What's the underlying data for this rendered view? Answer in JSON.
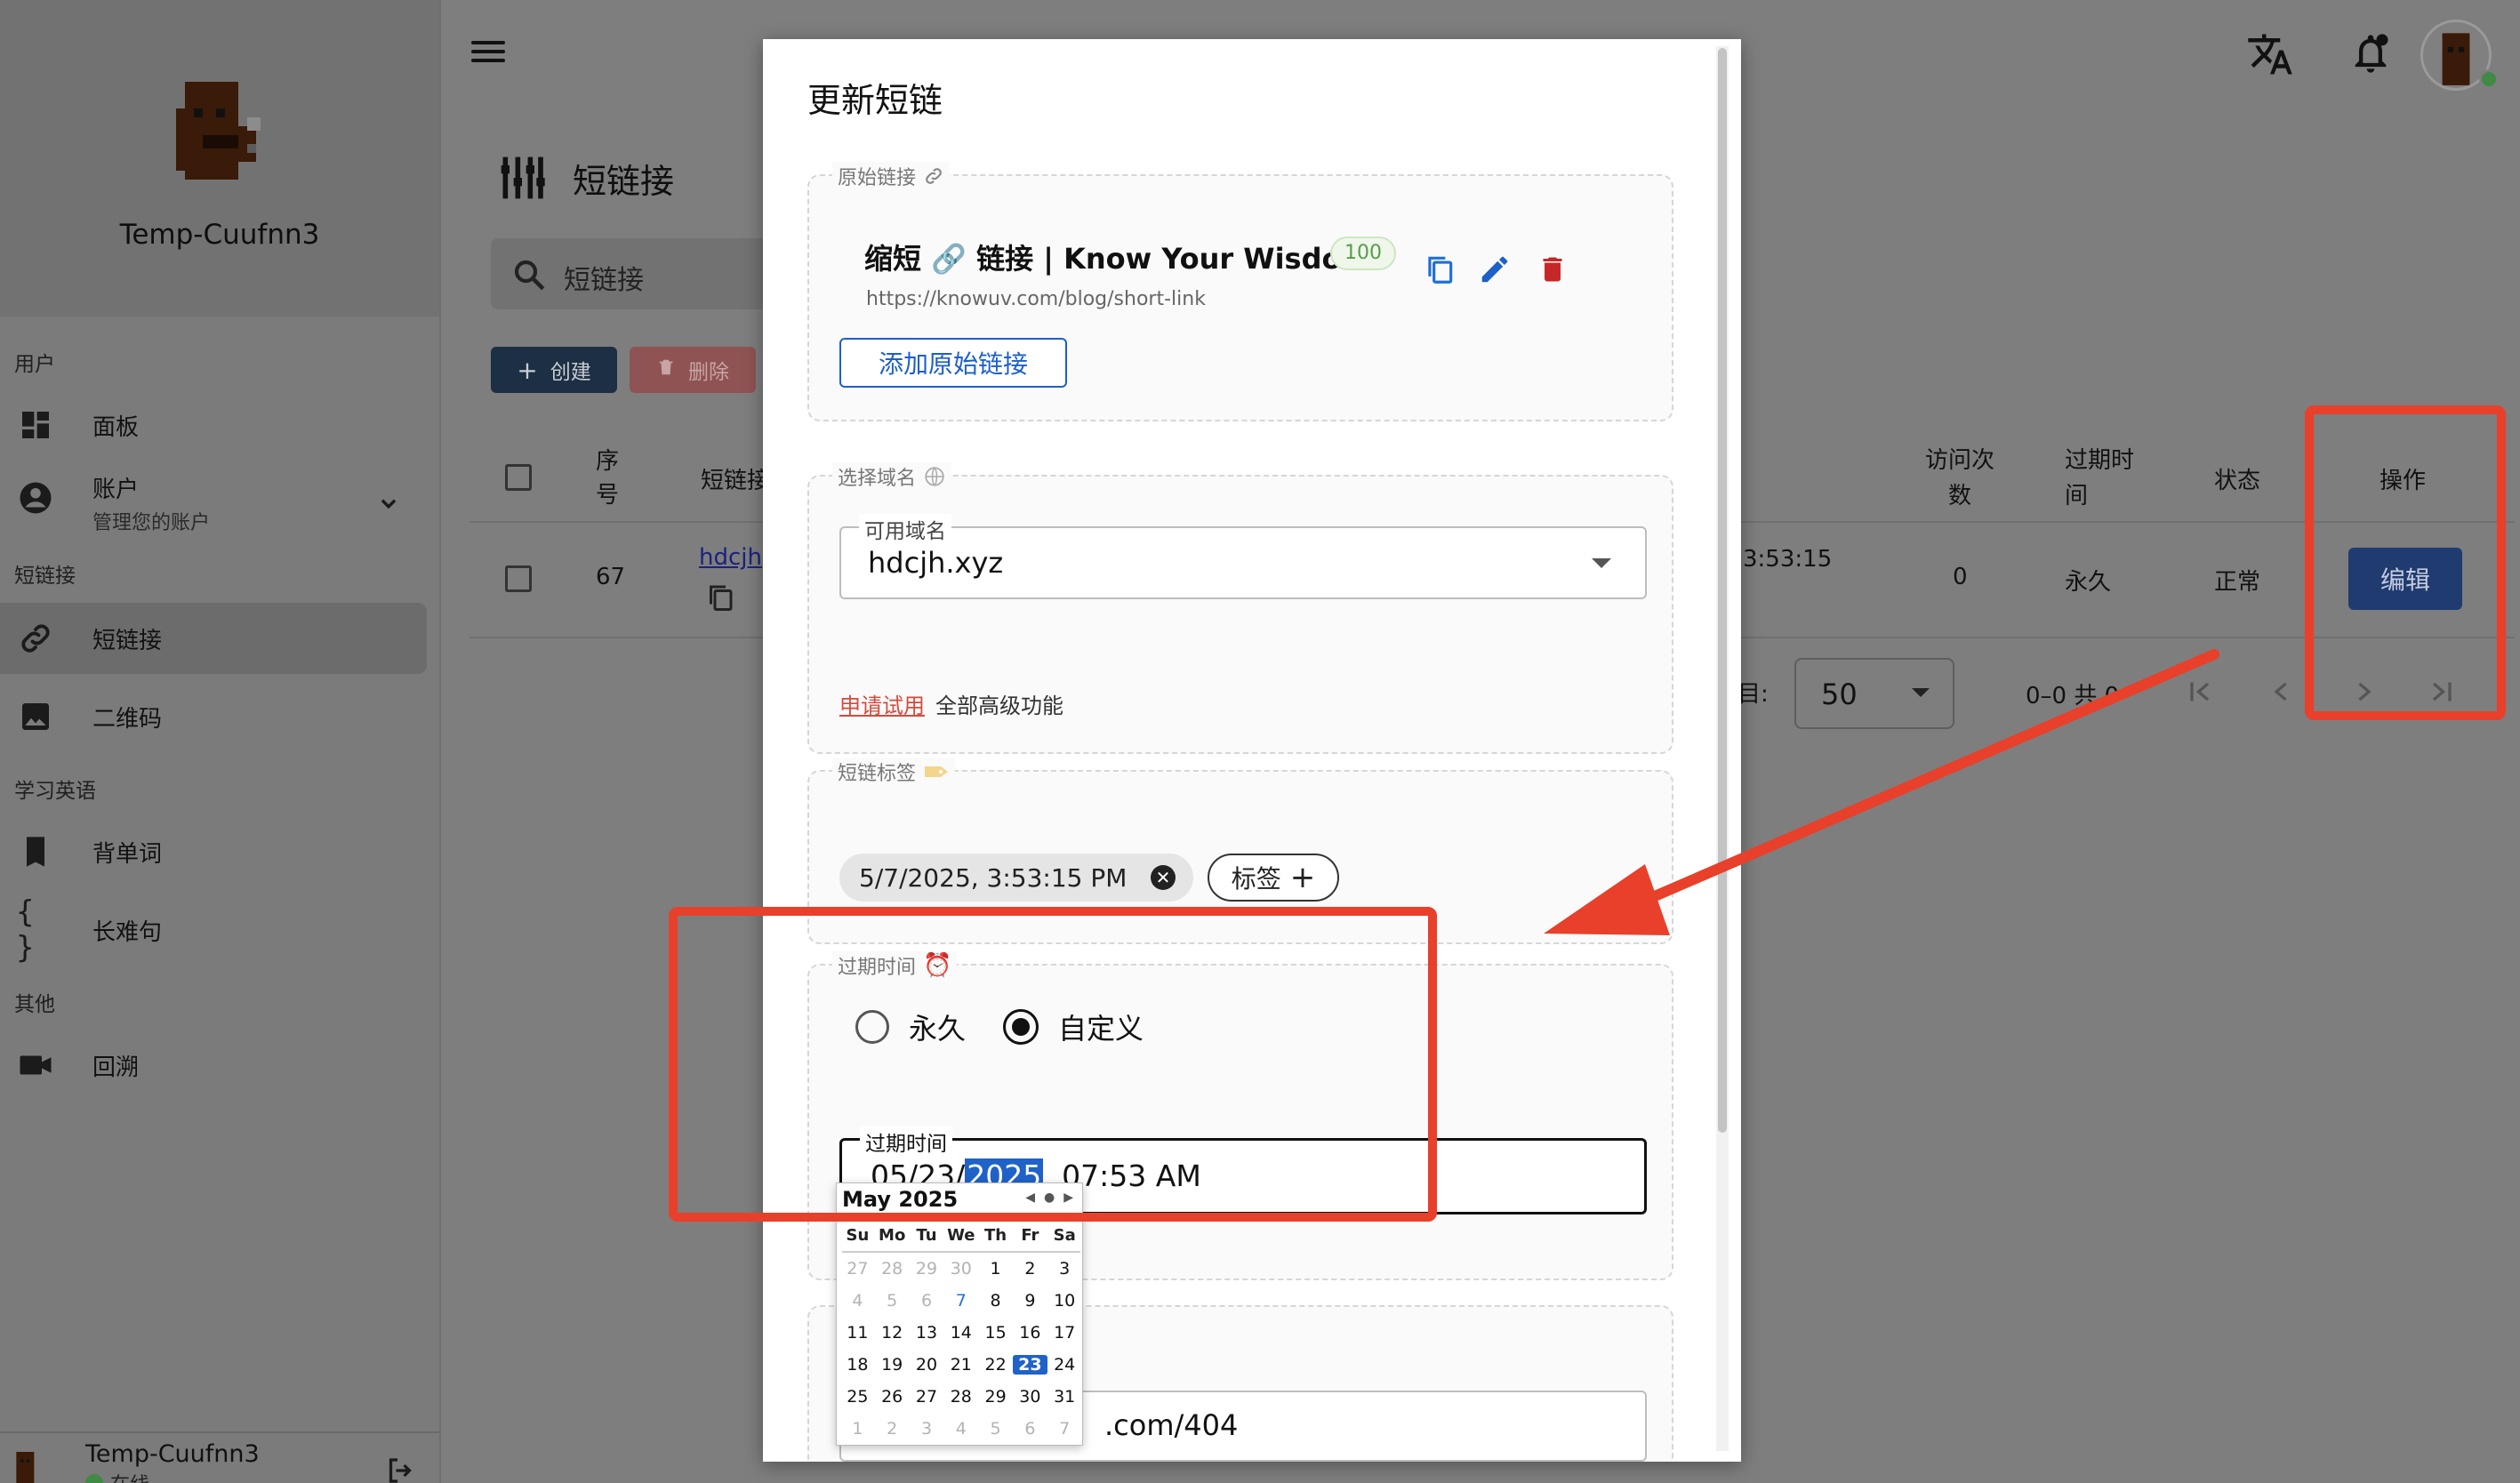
{
  "sidebar": {
    "profile_name": "Temp-Cuufnn3",
    "sections": {
      "user": "用户",
      "shortlink": "短链接",
      "english": "学习英语",
      "other": "其他"
    },
    "items": {
      "dashboard": "面板",
      "account": "账户",
      "account_sub": "管理您的账户",
      "shortlink": "短链接",
      "qrcode": "二维码",
      "vocab": "背单词",
      "sentence": "长难句",
      "playback": "回溯"
    },
    "footer_name": "Temp-Cuufnn3",
    "footer_status": "在线"
  },
  "page": {
    "heading": "短链接",
    "search_placeholder": "短链接",
    "create_label": "创建",
    "delete_label": "删除"
  },
  "table": {
    "headers": {
      "index": "序号",
      "shortlink": "短链接",
      "visits": "访问次数",
      "expire": "过期时间",
      "status": "状态",
      "action": "操作"
    },
    "row": {
      "index": "67",
      "shortlink": "hdcjh",
      "time": "3:53:15",
      "visits": "0",
      "expire": "永久",
      "status": "正常",
      "action": "编辑"
    },
    "pagination": {
      "rows_label": "目:",
      "rows_value": "50",
      "range": "0–0 共 0"
    }
  },
  "modal": {
    "title": "更新短链",
    "original": {
      "legend": "原始链接",
      "link_title": "缩短 🔗 链接 | Know Your Wisdom",
      "weight": "100",
      "url": "https://knowuv.com/blog/short-link",
      "add_button": "添加原始链接"
    },
    "domain": {
      "legend": "选择域名",
      "field_label": "可用域名",
      "value": "hdcjh.xyz",
      "trial_link": "申请试用",
      "trial_text": "全部高级功能"
    },
    "tags": {
      "legend": "短链标签",
      "chip": "5/7/2025, 3:53:15 PM",
      "add": "标签"
    },
    "expire": {
      "legend": "过期时间",
      "option_forever": "永久",
      "option_custom": "自定义",
      "selected": "custom",
      "field_label": "过期时间",
      "value_prefix": "05/23/",
      "value_highlight": "2025",
      "value_suffix": ", 07:53 AM"
    },
    "fallback": {
      "value": ".com/404"
    }
  },
  "calendar": {
    "month": "May 2025",
    "days_of_week": [
      "Su",
      "Mo",
      "Tu",
      "We",
      "Th",
      "Fr",
      "Sa"
    ],
    "weeks": [
      [
        "27",
        "28",
        "29",
        "30",
        "1",
        "2",
        "3"
      ],
      [
        "4",
        "5",
        "6",
        "7",
        "8",
        "9",
        "10"
      ],
      [
        "11",
        "12",
        "13",
        "14",
        "15",
        "16",
        "17"
      ],
      [
        "18",
        "19",
        "20",
        "21",
        "22",
        "23",
        "24"
      ],
      [
        "25",
        "26",
        "27",
        "28",
        "29",
        "30",
        "31"
      ],
      [
        "1",
        "2",
        "3",
        "4",
        "5",
        "6",
        "7"
      ]
    ],
    "selected_day": "23",
    "today_day": "7"
  },
  "colors": {
    "accent": "#1f3b6f",
    "annotation_red": "#e8402a",
    "danger": "#c62828",
    "online": "#4caf50"
  }
}
